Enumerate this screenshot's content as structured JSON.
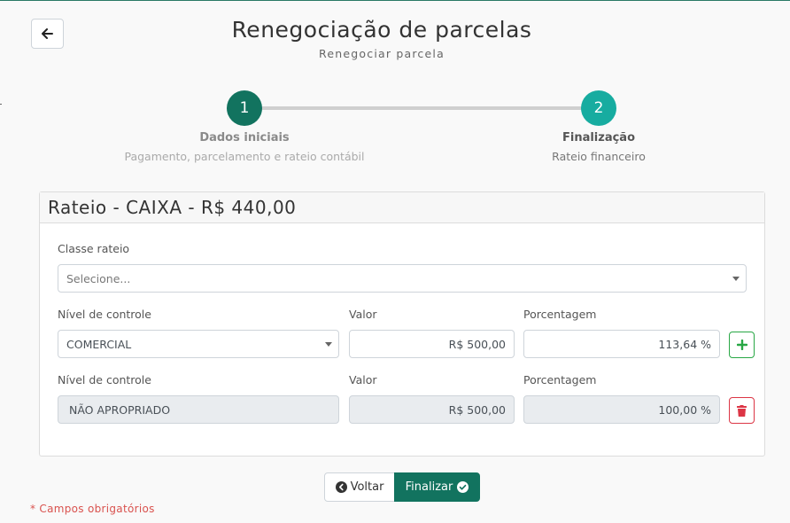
{
  "header": {
    "title": "Renegociação de parcelas",
    "subtitle": "Renegociar parcela",
    "back_icon": "arrow-left-icon"
  },
  "stepper": {
    "steps": [
      {
        "number": "1",
        "title": "Dados iniciais",
        "description": "Pagamento, parcelamento e rateio contábil",
        "color": "#12735f"
      },
      {
        "number": "2",
        "title": "Finalização",
        "description": "Rateio financeiro",
        "color": "#17aca0",
        "active": true
      }
    ]
  },
  "rateio": {
    "title": "Rateio - CAIXA - R$ 440,00",
    "classe_label": "Classe rateio",
    "classe_placeholder": "Selecione...",
    "rows": [
      {
        "nivel_label": "Nível de controle",
        "nivel_value": "COMERCIAL",
        "valor_label": "Valor",
        "valor_value": "R$ 500,00",
        "porcentagem_label": "Porcentagem",
        "porcentagem_value": "113,64 %",
        "action_icon": "plus-icon"
      },
      {
        "nivel_label": "Nível de controle",
        "nivel_value": "NÃO APROPRIADO",
        "valor_label": "Valor",
        "valor_value": "R$ 500,00",
        "porcentagem_label": "Porcentagem",
        "porcentagem_value": "100,00 %",
        "action_icon": "trash-icon"
      }
    ]
  },
  "footer": {
    "voltar_label": "Voltar",
    "finalizar_label": "Finalizar",
    "required_note": "* Campos obrigatórios"
  },
  "colors": {
    "primary": "#12735f",
    "step2": "#17aca0",
    "success": "#28a745",
    "danger": "#dc3545"
  }
}
